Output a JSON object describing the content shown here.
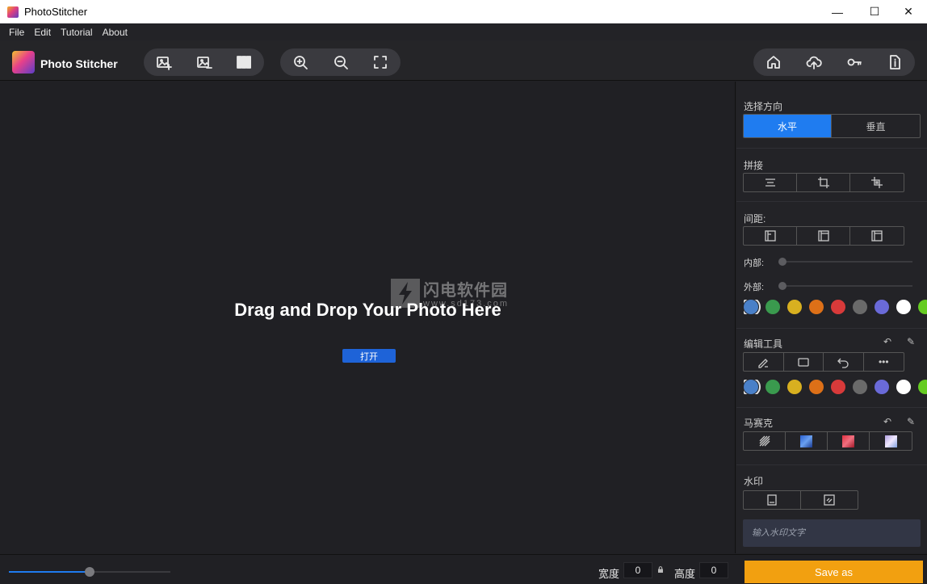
{
  "window": {
    "title": "PhotoStitcher",
    "controls": [
      "—",
      "☐",
      "✕"
    ]
  },
  "menu": [
    "File",
    "Edit",
    "Tutorial",
    "About"
  ],
  "toolbar": {
    "app_name": "Photo Stitcher",
    "group1": [
      "add-image-icon",
      "remove-image-icon",
      "columns-icon"
    ],
    "group2": [
      "zoom-in-icon",
      "zoom-out-icon",
      "fullscreen-icon"
    ],
    "group3": [
      "home-icon",
      "upload-icon",
      "key-icon",
      "info-doc-icon"
    ]
  },
  "canvas": {
    "drop_text": "Drag and Drop Your Photo Here",
    "open_label": "打开",
    "watermark_cn": "闪电软件园",
    "watermark_url": "www.sd173.com"
  },
  "panel": {
    "direction": {
      "label": "选择方向",
      "options": [
        "水平",
        "垂直"
      ],
      "selected": "水平"
    },
    "stitch": {
      "label": "拼接"
    },
    "spacing": {
      "label": "间距:",
      "inner_label": "内部:",
      "outer_label": "外部:",
      "inner_value": 0,
      "outer_value": 0
    },
    "spacing_colors": [
      "#4a80c8",
      "#3a9a4e",
      "#d8b020",
      "#dd7018",
      "#d83a3a",
      "#6a6a6a",
      "#6a6ad8",
      "#ffffff",
      "#66cc22"
    ],
    "edit_tools": {
      "label": "编辑工具",
      "more": "•••"
    },
    "edit_colors": [
      "#4a80c8",
      "#3a9a4e",
      "#d8b020",
      "#dd7018",
      "#d83a3a",
      "#6a6a6a",
      "#6a6ad8",
      "#ffffff",
      "#66cc22"
    ],
    "mosaic": {
      "label": "马赛克"
    },
    "watermark": {
      "label": "水印",
      "placeholder": "输入水印文字"
    }
  },
  "bottom": {
    "zoom_fraction": 0.5,
    "width_label": "宽度",
    "width_value": "0",
    "height_label": "高度",
    "height_value": "0",
    "save_label": "Save as"
  }
}
